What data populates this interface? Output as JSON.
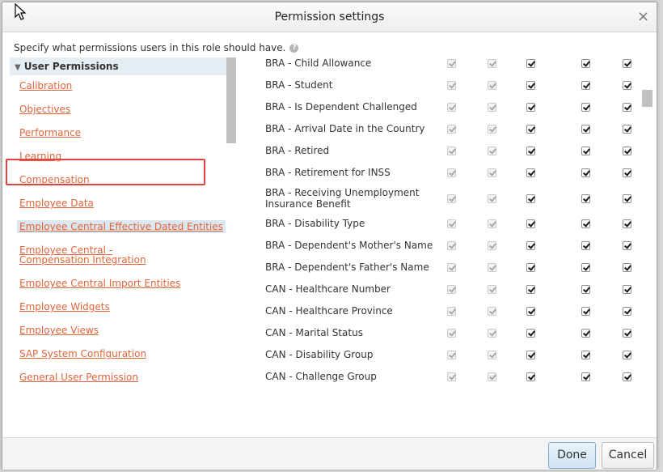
{
  "dialog": {
    "title": "Permission settings",
    "instruction": "Specify what permissions users in this role should have.",
    "help_icon": "question-mark-icon",
    "close_label": "×"
  },
  "left_panel": {
    "section_header": "User Permissions",
    "links": [
      "Calibration",
      "Objectives",
      "Performance",
      "Learning",
      "Compensation",
      "Employee Data",
      "Employee Central Effective Dated Entities",
      "Employee Central - Compensation Integration",
      "Employee Central Import Entities",
      "Employee Widgets",
      "Employee Views",
      "SAP System Configuration",
      "General User Permission"
    ],
    "selected_index": 6
  },
  "permissions": {
    "rows": [
      "BRA - Child Allowance",
      "BRA - Student",
      "BRA - Is Dependent Challenged",
      "BRA - Arrival Date in the Country",
      "BRA - Retired",
      "BRA - Retirement for INSS",
      "BRA - Receiving Unemployment Insurance Benefit",
      "BRA - Disability Type",
      "BRA - Dependent's Mother's Name",
      "BRA - Dependent's Father's Name",
      "CAN - Healthcare Number",
      "CAN - Healthcare Province",
      "CAN - Marital Status",
      "CAN - Disability Group",
      "CAN - Challenge Group"
    ],
    "column_states": [
      "disabled-checked",
      "disabled-checked",
      "checked",
      "checked",
      "checked"
    ]
  },
  "footer": {
    "done_label": "Done",
    "cancel_label": "Cancel"
  }
}
